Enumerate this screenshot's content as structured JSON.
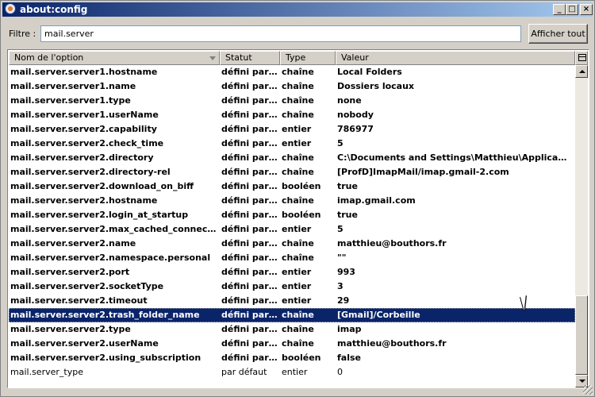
{
  "window": {
    "title": "about:config"
  },
  "filter": {
    "label": "Filtre :",
    "value": "mail.server"
  },
  "toolbar": {
    "show_all_label": "Afficher tout"
  },
  "columns": {
    "name": "Nom de l'option",
    "status": "Statut",
    "type": "Type",
    "value": "Valeur"
  },
  "rows": [
    {
      "name": "mail.server.server1.hostname",
      "status": "défini par l'...",
      "type": "chaîne",
      "value": "Local Folders",
      "modified": true
    },
    {
      "name": "mail.server.server1.name",
      "status": "défini par l'...",
      "type": "chaîne",
      "value": "Dossiers locaux",
      "modified": true
    },
    {
      "name": "mail.server.server1.type",
      "status": "défini par l'...",
      "type": "chaîne",
      "value": "none",
      "modified": true
    },
    {
      "name": "mail.server.server1.userName",
      "status": "défini par l'...",
      "type": "chaîne",
      "value": "nobody",
      "modified": true
    },
    {
      "name": "mail.server.server2.capability",
      "status": "défini par l'...",
      "type": "entier",
      "value": "786977",
      "modified": true
    },
    {
      "name": "mail.server.server2.check_time",
      "status": "défini par l'...",
      "type": "entier",
      "value": "5",
      "modified": true
    },
    {
      "name": "mail.server.server2.directory",
      "status": "défini par l'...",
      "type": "chaîne",
      "value": "C:\\Documents and Settings\\Matthieu\\Application ...",
      "modified": true
    },
    {
      "name": "mail.server.server2.directory-rel",
      "status": "défini par l'...",
      "type": "chaîne",
      "value": "[ProfD]ImapMail/imap.gmail-2.com",
      "modified": true
    },
    {
      "name": "mail.server.server2.download_on_biff",
      "status": "défini par l'...",
      "type": "booléen",
      "value": "true",
      "modified": true
    },
    {
      "name": "mail.server.server2.hostname",
      "status": "défini par l'...",
      "type": "chaîne",
      "value": "imap.gmail.com",
      "modified": true
    },
    {
      "name": "mail.server.server2.login_at_startup",
      "status": "défini par l'...",
      "type": "booléen",
      "value": "true",
      "modified": true
    },
    {
      "name": "mail.server.server2.max_cached_connections",
      "status": "défini par l'...",
      "type": "entier",
      "value": "5",
      "modified": true
    },
    {
      "name": "mail.server.server2.name",
      "status": "défini par l'...",
      "type": "chaîne",
      "value": "matthieu@bouthors.fr",
      "modified": true
    },
    {
      "name": "mail.server.server2.namespace.personal",
      "status": "défini par l'...",
      "type": "chaîne",
      "value": "\"\"",
      "modified": true
    },
    {
      "name": "mail.server.server2.port",
      "status": "défini par l'...",
      "type": "entier",
      "value": "993",
      "modified": true
    },
    {
      "name": "mail.server.server2.socketType",
      "status": "défini par l'...",
      "type": "entier",
      "value": "3",
      "modified": true
    },
    {
      "name": "mail.server.server2.timeout",
      "status": "défini par l'...",
      "type": "entier",
      "value": "29",
      "modified": true
    },
    {
      "name": "mail.server.server2.trash_folder_name",
      "status": "défini par l'...",
      "type": "chaîne",
      "value": "[Gmail]/Corbeille",
      "modified": true,
      "selected": true
    },
    {
      "name": "mail.server.server2.type",
      "status": "défini par l'...",
      "type": "chaîne",
      "value": "imap",
      "modified": true
    },
    {
      "name": "mail.server.server2.userName",
      "status": "défini par l'...",
      "type": "chaîne",
      "value": "matthieu@bouthors.fr",
      "modified": true
    },
    {
      "name": "mail.server.server2.using_subscription",
      "status": "défini par l'...",
      "type": "booléen",
      "value": "false",
      "modified": true
    },
    {
      "name": "mail.server_type",
      "status": "par défaut",
      "type": "entier",
      "value": "0",
      "modified": false
    }
  ],
  "colors": {
    "selection": "#0a246a",
    "title_start": "#0a246a",
    "title_end": "#a6caf0"
  },
  "icons": {
    "app": "thunderbird-icon",
    "minimize": "minimize-icon",
    "maximize": "maximize-icon",
    "close": "close-icon",
    "column_picker": "column-picker-icon"
  }
}
